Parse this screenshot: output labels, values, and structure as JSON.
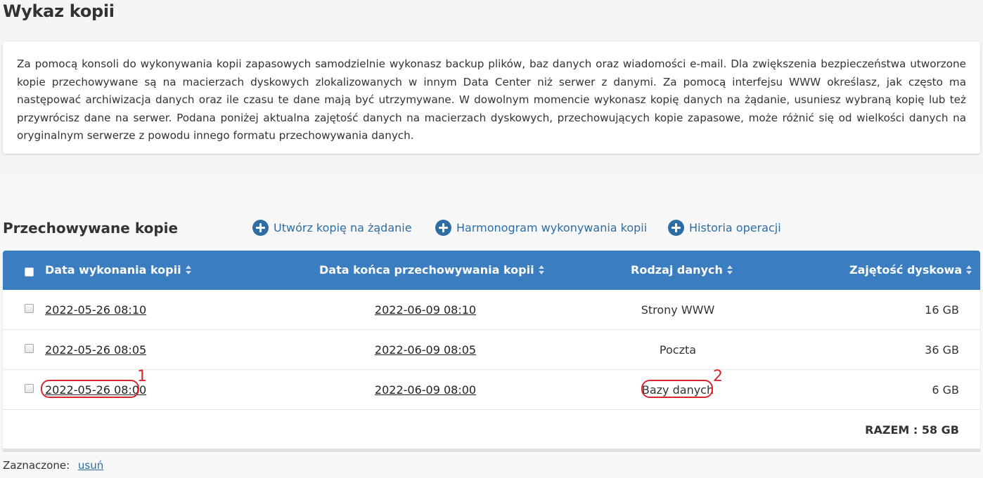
{
  "page": {
    "title": "Wykaz kopii"
  },
  "intro": {
    "text": "Za pomocą konsoli do wykonywania kopii zapasowych samodzielnie wykonasz backup plików, baz danych oraz wiadomości e-mail. Dla zwiększenia bezpieczeństwa utworzone kopie przechowywane są na macierzach dyskowych zlokalizowanych w innym Data Center niż serwer z danymi. Za pomocą interfejsu WWW określasz, jak często ma następować archiwizacja danych oraz ile czasu te dane mają być utrzymywane. W dowolnym momencie wykonasz kopię danych na żądanie, usuniesz wybraną kopię lub też przywrócisz dane na serwer. Podana poniżej aktualna zajętość danych na macierzach dyskowych, przechowujących kopie zapasowe, może różnić się od wielkości danych na oryginalnym serwerze z powodu innego formatu przechowywania danych."
  },
  "section": {
    "title": "Przechowywane kopie",
    "actions": [
      {
        "label": "Utwórz kopię na żądanie",
        "icon": "plus-circle-icon"
      },
      {
        "label": "Harmonogram wykonywania kopii",
        "icon": "plus-circle-icon"
      },
      {
        "label": "Historia operacji",
        "icon": "plus-circle-icon"
      }
    ]
  },
  "table": {
    "headers": [
      "Data wykonania kopii",
      "Data końca przechowywania kopii",
      "Rodzaj danych",
      "Zajętość dyskowa"
    ],
    "rows": [
      {
        "date": "2022-05-26 08:10",
        "end": "2022-06-09 08:10",
        "type": "Strony WWW",
        "size": "16 GB"
      },
      {
        "date": "2022-05-26 08:05",
        "end": "2022-06-09 08:05",
        "type": "Poczta",
        "size": "36 GB"
      },
      {
        "date": "2022-05-26 08:00",
        "end": "2022-06-09 08:00",
        "type": "Bazy danych",
        "size": "6 GB"
      }
    ],
    "total": "RAZEM : 58 GB"
  },
  "annotations": {
    "marker1": "1",
    "marker2": "2",
    "color": "#d8262f"
  },
  "footer": {
    "label": "Zaznaczone:",
    "delete_link": "usuń"
  },
  "colors": {
    "header_bg": "#3a7dc0",
    "link": "#2e6da4"
  }
}
